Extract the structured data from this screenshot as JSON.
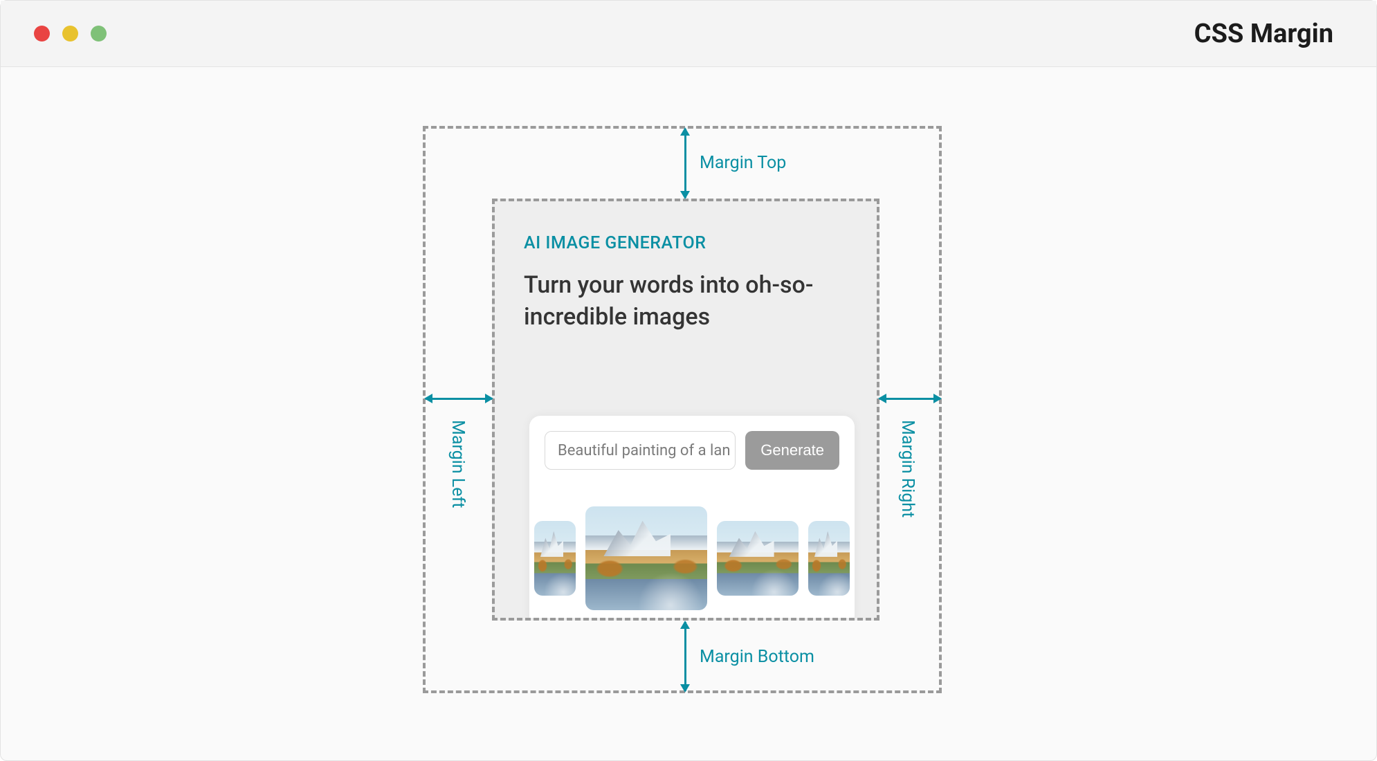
{
  "window": {
    "title": "CSS Margin"
  },
  "labels": {
    "top": "Margin Top",
    "bottom": "Margin Bottom",
    "left": "Margin Left",
    "right": "Margin Right"
  },
  "card": {
    "eyebrow": "AI IMAGE GENERATOR",
    "headline": "Turn your words into oh-so-incredible images",
    "prompt_value": "Beautiful painting of a lan",
    "generate_label": "Generate"
  }
}
